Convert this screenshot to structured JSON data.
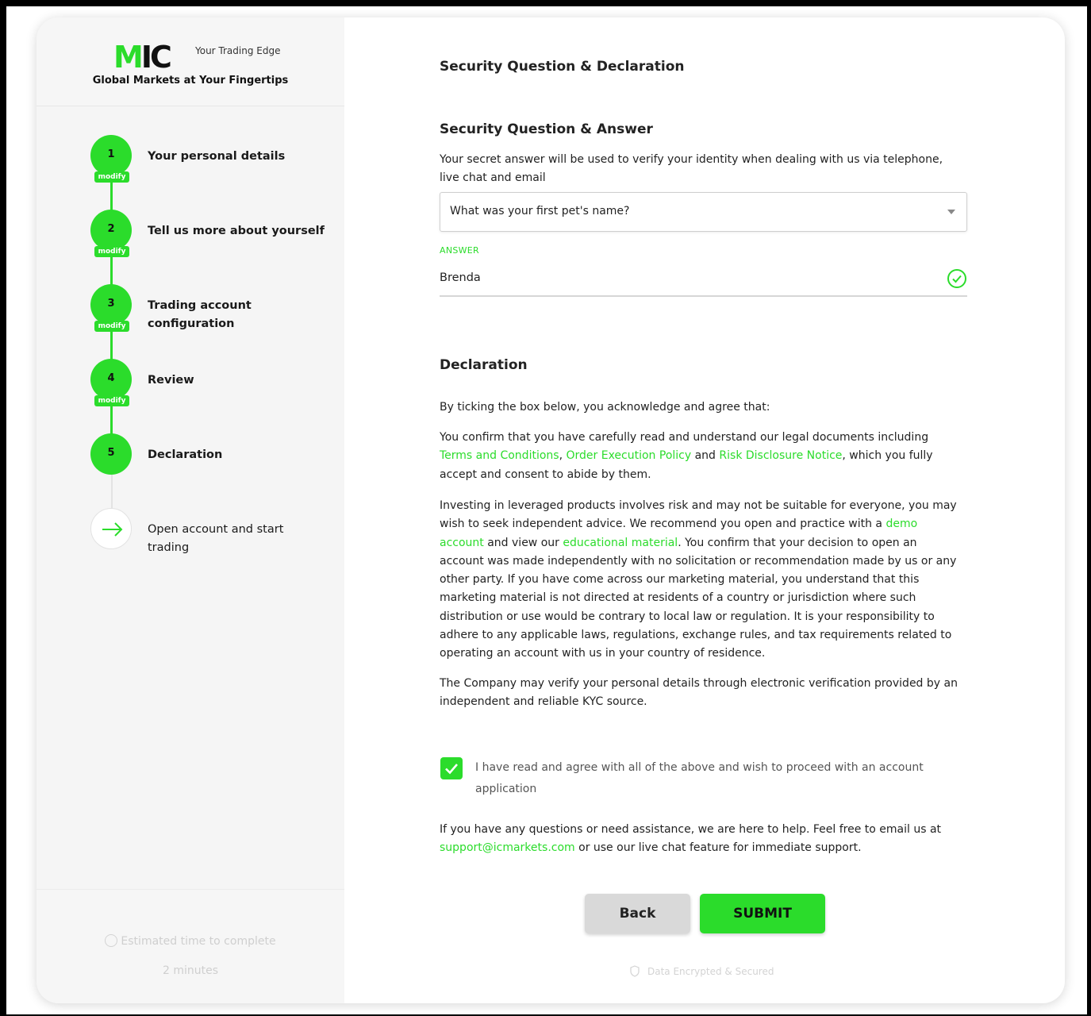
{
  "brand": {
    "logo_text": "IC",
    "logo_mark": "M",
    "tagline": "Your Trading Edge",
    "subtitle": "Global Markets at Your Fingertips"
  },
  "steps": [
    {
      "number": "1",
      "label": "Your personal details",
      "badge": "modify"
    },
    {
      "number": "2",
      "label": "Tell us more about yourself",
      "badge": "modify"
    },
    {
      "number": "3",
      "label": "Trading account configuration",
      "badge": "modify"
    },
    {
      "number": "4",
      "label": "Review",
      "badge": "modify"
    },
    {
      "number": "5",
      "label": "Declaration"
    },
    {
      "label": "Open account and start trading",
      "icon": "arrow-right-icon"
    }
  ],
  "sidebar_footer": {
    "estimated_label": "Estimated time to complete",
    "estimated_value": "2 minutes"
  },
  "page_title": "Security Question & Declaration",
  "security": {
    "heading": "Security Question & Answer",
    "description": "Your secret answer will be used to verify your identity when dealing with us via telephone, live chat and email",
    "question_selected": "What was your first pet's name?",
    "answer_label": "ANSWER",
    "answer_value": "Brenda"
  },
  "declaration": {
    "heading": "Declaration",
    "intro": "By ticking the box below, you acknowledge and agree that:",
    "p1": {
      "a": "You confirm that you have carefully read and understand our legal documents including ",
      "link1": "Terms and Conditions",
      "b": ", ",
      "link2": "Order Execution Policy",
      "c": " and ",
      "link3": "Risk Disclosure Notice",
      "d": ", which you fully accept and consent to abide by them."
    },
    "p2": {
      "a": "Investing in leveraged products involves risk and may not be suitable for everyone, you may wish to seek independent advice. We recommend you open and practice with a ",
      "link1": "demo account",
      "b": " and view our ",
      "link2": "educational material",
      "c": ". You confirm that your decision to open an account was made independently with no solicitation or recommendation made by us or any other party. If you have come across our marketing material, you understand that this marketing material is not directed at residents of a country or jurisdiction where such distribution or use would be contrary to local law or regulation. It is your responsibility to adhere to any applicable laws, regulations, exchange rules, and tax requirements related to operating an account with us in your country of residence."
    },
    "p3": "The Company may verify your personal details through electronic verification provided by an independent and reliable KYC source.",
    "checkbox_label": "I have read and agree with all of the above and wish to proceed with an account application",
    "checkbox_checked": true
  },
  "help": {
    "a": "If you have any questions or need assistance, we are here to help. Feel free to email us at ",
    "email": "support@icmarkets.com",
    "b": " or use our live chat feature for immediate support."
  },
  "buttons": {
    "back": "Back",
    "submit": "SUBMIT"
  },
  "secure_note": "Data Encrypted & Secured",
  "colors": {
    "accent": "#2bdc2b",
    "sidebar_bg": "#f5f5f5",
    "text": "#222222"
  }
}
